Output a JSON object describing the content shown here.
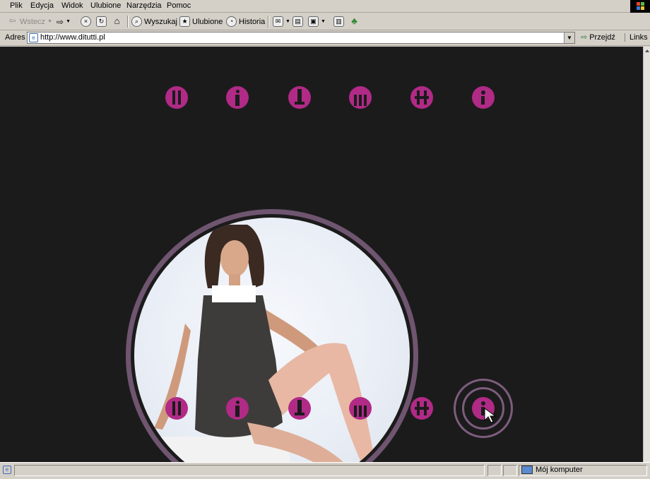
{
  "menu": [
    "Plik",
    "Edycja",
    "Widok",
    "Ulubione",
    "Narzędzia",
    "Pomoc"
  ],
  "toolbar": {
    "back_label": "Wstecz",
    "search_label": "Wyszukaj",
    "favorites_label": "Ulubione",
    "history_label": "Historia"
  },
  "address": {
    "label": "Adres",
    "url": "http://www.ditutti.pl",
    "go_label": "Przejdź",
    "links_label": "Links"
  },
  "status": {
    "zone_label": "Mój komputer"
  },
  "colors": {
    "accent": "#b02a86",
    "page_bg": "#1c1b1c",
    "ring": "#6f5570"
  },
  "icons": {
    "top_row": 6,
    "bottom_row": 6
  }
}
